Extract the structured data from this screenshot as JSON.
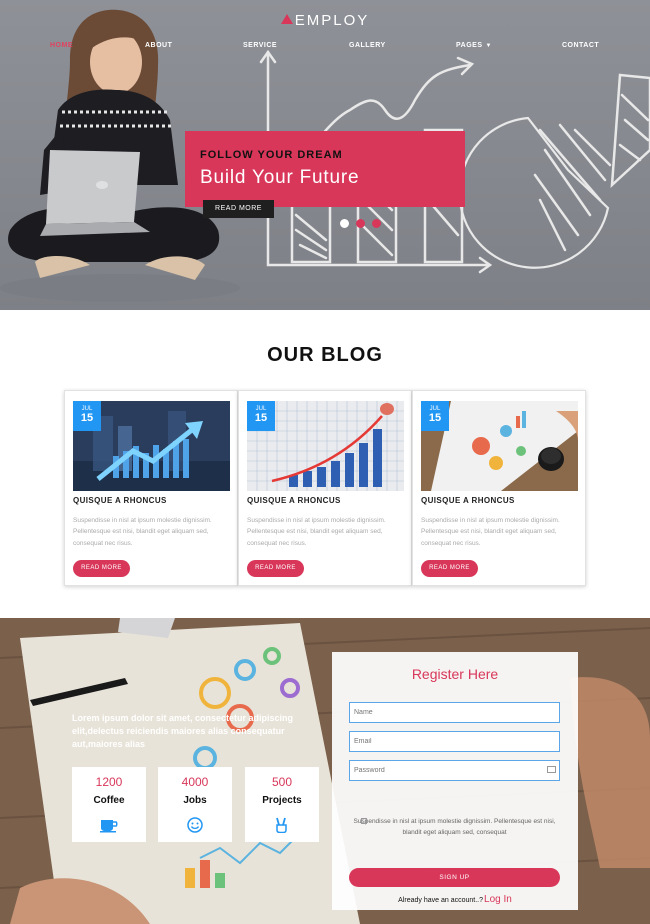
{
  "brand": {
    "logo": "EMPLOY",
    "accent": "#d8375a",
    "badge": "#2196f3"
  },
  "nav": {
    "items": [
      {
        "label": "HOME",
        "active": true
      },
      {
        "label": "ABOUT"
      },
      {
        "label": "SERVICE"
      },
      {
        "label": "GALLERY"
      },
      {
        "label": "PAGES",
        "dropdown": true
      },
      {
        "label": "CONTACT"
      }
    ]
  },
  "hero": {
    "kicker": "FOLLOW YOUR DREAM",
    "title": "Build Your Future",
    "button": "READ MORE",
    "slides_active": 1,
    "slides_total": 3
  },
  "blog": {
    "title": "OUR BLOG",
    "posts": [
      {
        "month": "JUL",
        "day": "15",
        "heading": "QUISQUE A RHONCUS",
        "text": "Suspendisse in nisl at ipsum molestie dignissim. Pellentesque est nisi, blandit eget aliquam sed, consequat nec risus.",
        "button": "READ MORE"
      },
      {
        "month": "JUL",
        "day": "15",
        "heading": "QUISQUE A RHONCUS",
        "text": "Suspendisse in nisl at ipsum molestie dignissim. Pellentesque est nisi, blandit eget aliquam sed, consequat nec risus.",
        "button": "READ MORE"
      },
      {
        "month": "JUL",
        "day": "15",
        "heading": "QUISQUE A RHONCUS",
        "text": "Suspendisse in nisl at ipsum molestie dignissim. Pellentesque est nisi, blandit eget aliquam sed, consequat nec risus.",
        "button": "READ MORE"
      }
    ]
  },
  "stats": {
    "intro": "Lorem ipsum dolor sit amet, consectetur adipiscing elit,delectus reiciendis maiores alias consequatur aut,maiores alias",
    "items": [
      {
        "number": "1200",
        "label": "Coffee",
        "icon": "coffee-cup-icon"
      },
      {
        "number": "4000",
        "label": "Jobs",
        "icon": "smiley-icon"
      },
      {
        "number": "500",
        "label": "Projects",
        "icon": "peace-hand-icon"
      }
    ]
  },
  "register": {
    "title": "Register Here",
    "name_placeholder": "Name",
    "email_placeholder": "Email",
    "password_placeholder": "Password",
    "terms": "Suspendisse in nisl at ipsum molestie dignissim. Pellentesque est nisi, blandit eget aliquam sed, consequat",
    "signup": "SIGN UP",
    "have_account": "Already have an account..?",
    "login": "Log In"
  }
}
